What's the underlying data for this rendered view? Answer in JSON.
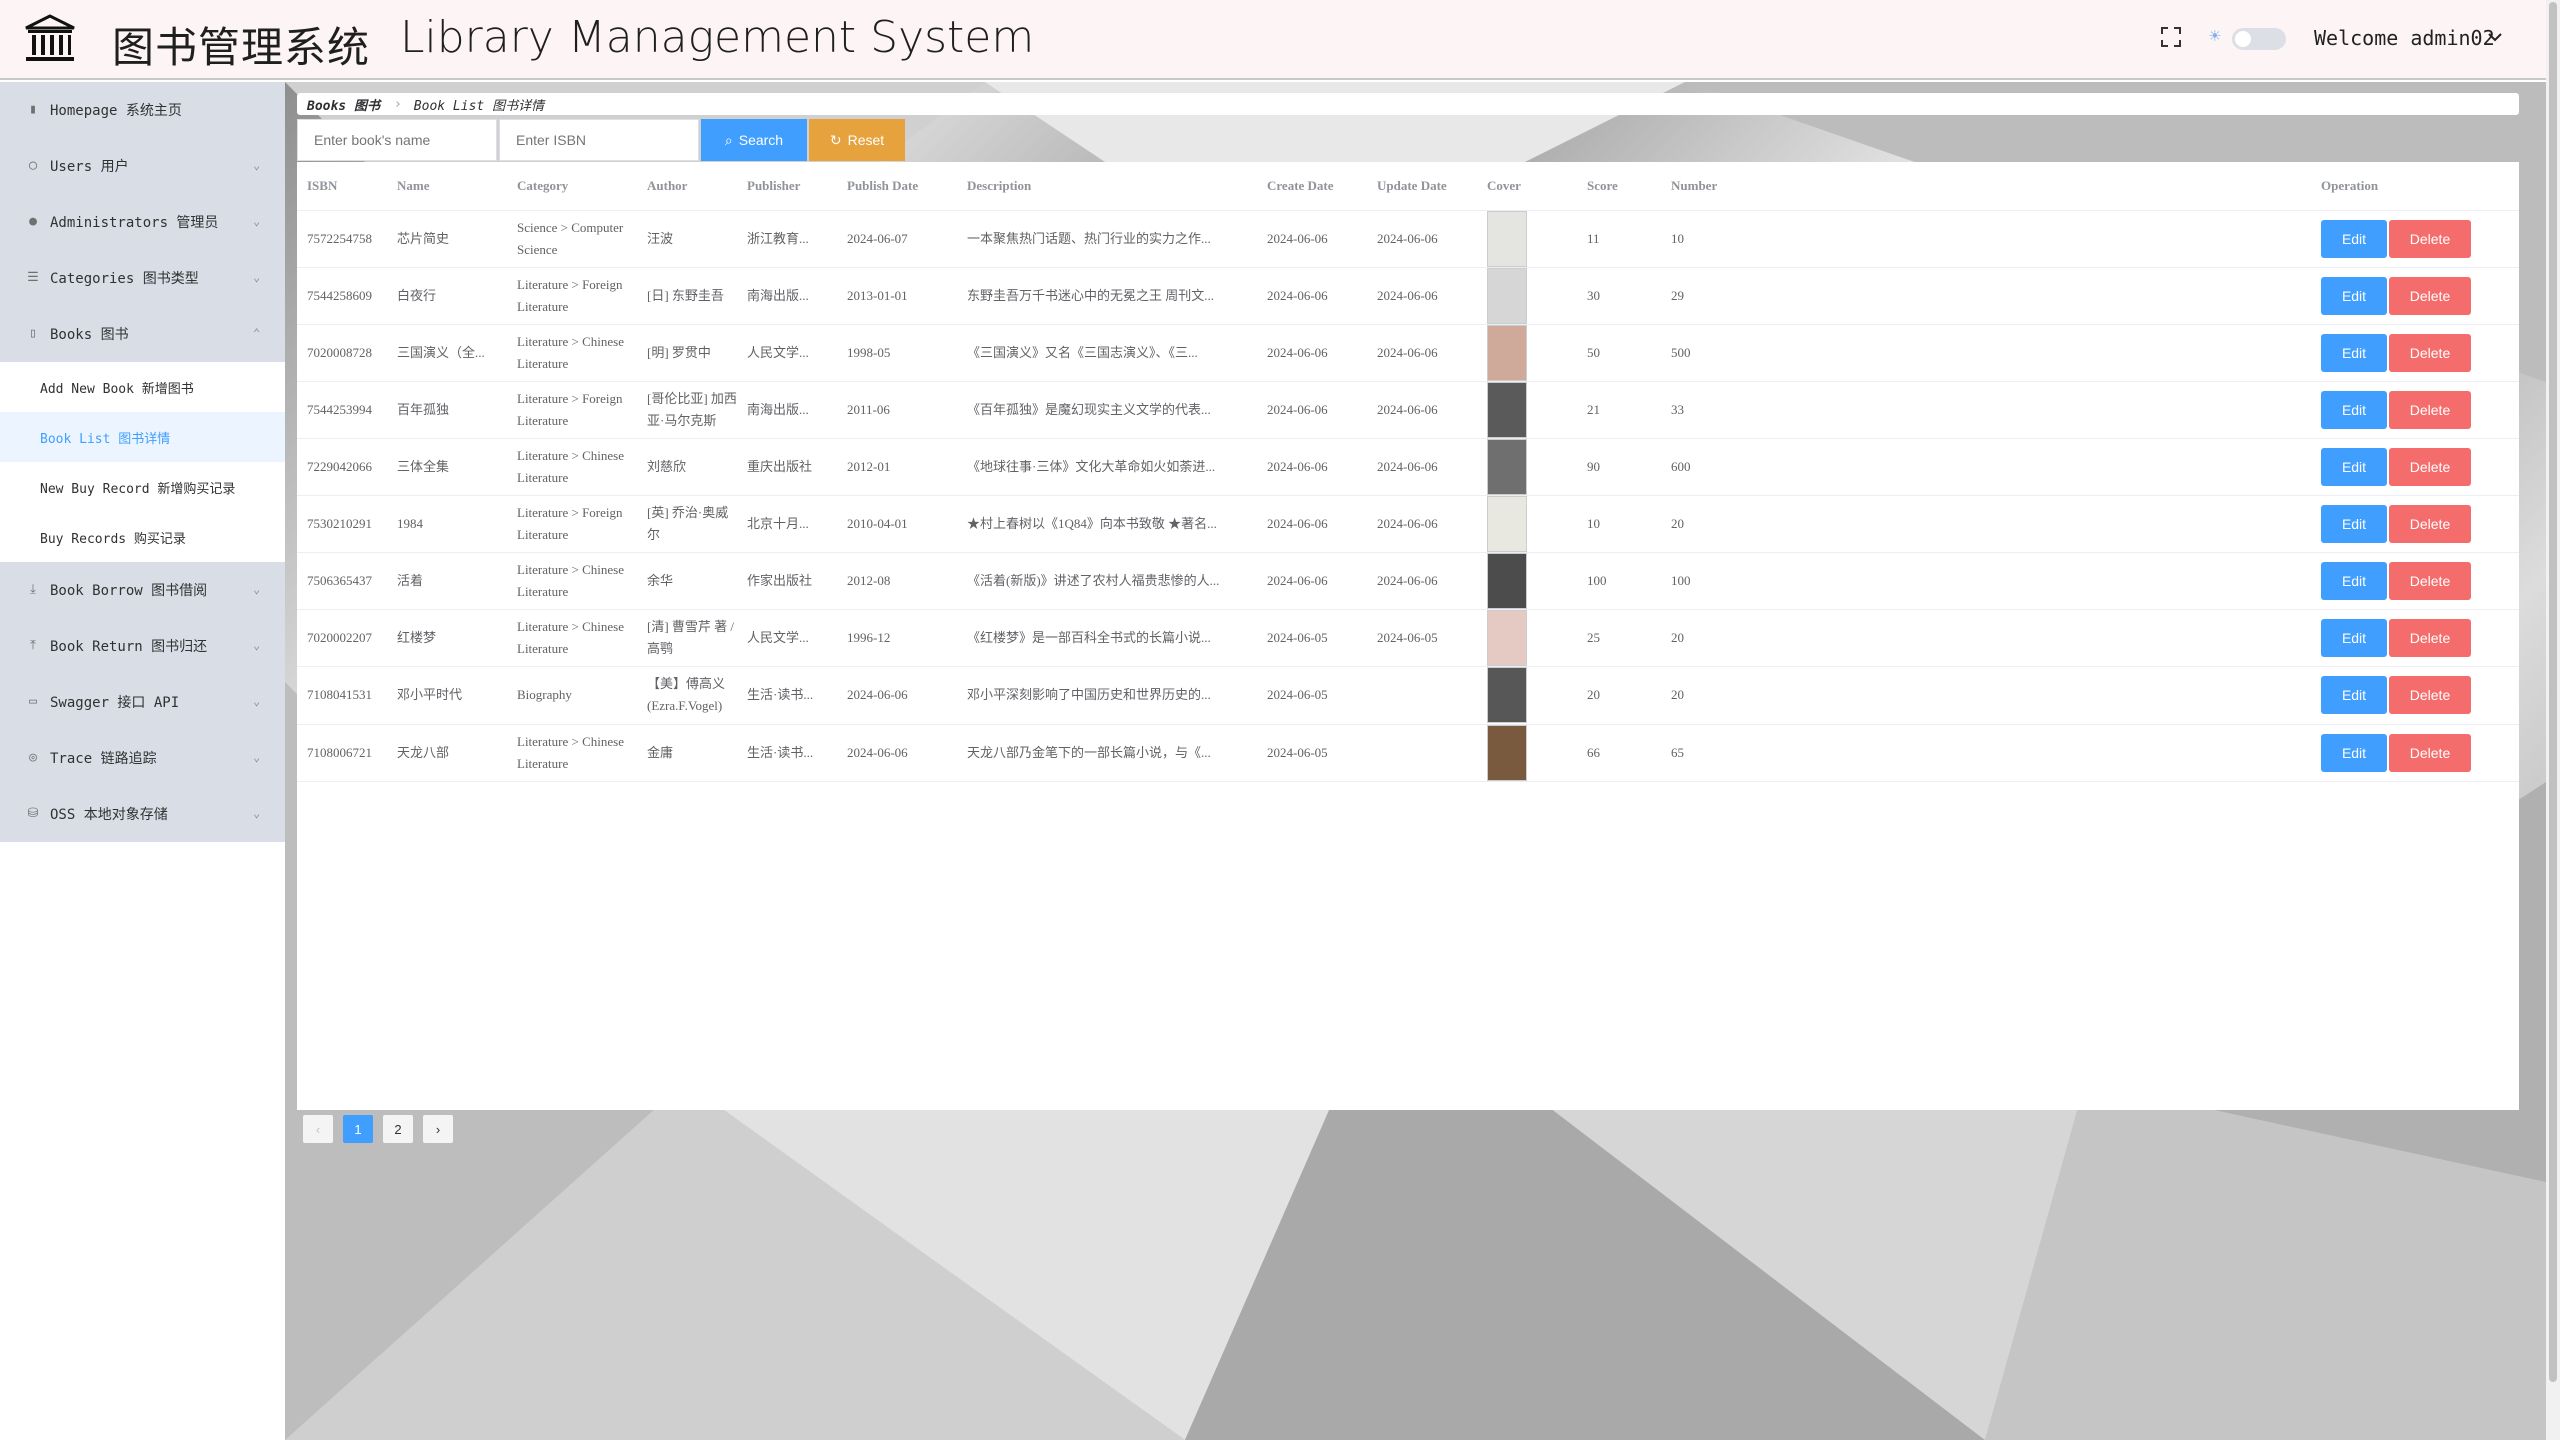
{
  "header": {
    "title_cn": "图书管理系统",
    "title_en": "Library Management System",
    "welcome": "Welcome admin02"
  },
  "sidebar": {
    "items": [
      {
        "label": "Homepage 系统主页",
        "icon": "bar-chart-icon",
        "has_chevron": false
      },
      {
        "label": "Users 用户",
        "icon": "user-icon",
        "has_chevron": true
      },
      {
        "label": "Administrators 管理员",
        "icon": "admin-icon",
        "has_chevron": true
      },
      {
        "label": "Categories 图书类型",
        "icon": "list-icon",
        "has_chevron": true
      },
      {
        "label": "Books 图书",
        "icon": "book-icon",
        "has_chevron": true,
        "expanded": true
      }
    ],
    "books_sub": [
      {
        "label": "Add New Book 新增图书",
        "active": false
      },
      {
        "label": "Book List 图书详情",
        "active": true
      },
      {
        "label": "New Buy Record 新增购买记录",
        "active": false
      },
      {
        "label": "Buy Records 购买记录",
        "active": false
      }
    ],
    "items_after": [
      {
        "label": "Book Borrow 图书借阅",
        "icon": "download-icon"
      },
      {
        "label": "Book Return 图书归还",
        "icon": "upload-icon"
      },
      {
        "label": "Swagger 接口 API",
        "icon": "folder-icon"
      },
      {
        "label": "Trace 链路追踪",
        "icon": "trace-icon"
      },
      {
        "label": "OSS 本地对象存储",
        "icon": "database-icon"
      }
    ]
  },
  "breadcrumb": {
    "first": "Books 图书",
    "second": "Book List 图书详情"
  },
  "search": {
    "name_placeholder": "Enter book's name",
    "isbn_placeholder": "Enter ISBN",
    "search_label": "Search",
    "reset_label": "Reset"
  },
  "table": {
    "columns": [
      "ISBN",
      "Name",
      "Category",
      "Author",
      "Publisher",
      "Publish Date",
      "Description",
      "Create Date",
      "Update Date",
      "Cover",
      "Score",
      "Number",
      "Operation"
    ],
    "edit_label": "Edit",
    "delete_label": "Delete",
    "rows": [
      {
        "isbn": "7572254758",
        "name": "芯片简史",
        "category": "Science > Computer Science",
        "author": "汪波",
        "publisher": "浙江教育...",
        "publish_date": "2024-06-07",
        "description": "一本聚焦热门话题、热门行业的实力之作...",
        "create_date": "2024-06-06",
        "update_date": "2024-06-06",
        "cover_color": "#e4e4e0",
        "score": "11",
        "number": "10"
      },
      {
        "isbn": "7544258609",
        "name": "白夜行",
        "category": "Literature > Foreign Literature",
        "author": "[日] 东野圭吾",
        "publisher": "南海出版...",
        "publish_date": "2013-01-01",
        "description": "东野圭吾万千书迷心中的无冕之王 周刊文...",
        "create_date": "2024-06-06",
        "update_date": "2024-06-06",
        "cover_color": "#d6d6d6",
        "score": "30",
        "number": "29"
      },
      {
        "isbn": "7020008728",
        "name": "三国演义（全...",
        "category": "Literature > Chinese Literature",
        "author": "[明] 罗贯中",
        "publisher": "人民文学...",
        "publish_date": "1998-05",
        "description": "《三国演义》又名《三国志演义》、《三...",
        "create_date": "2024-06-06",
        "update_date": "2024-06-06",
        "cover_color": "#cfa99a",
        "score": "50",
        "number": "500"
      },
      {
        "isbn": "7544253994",
        "name": "百年孤独",
        "category": "Literature > Foreign Literature",
        "author": "[哥伦比亚] 加西亚·马尔克斯",
        "publisher": "南海出版...",
        "publish_date": "2011-06",
        "description": "《百年孤独》是魔幻现实主义文学的代表...",
        "create_date": "2024-06-06",
        "update_date": "2024-06-06",
        "cover_color": "#5a5a5a",
        "score": "21",
        "number": "33"
      },
      {
        "isbn": "7229042066",
        "name": "三体全集",
        "category": "Literature > Chinese Literature",
        "author": "刘慈欣",
        "publisher": "重庆出版社",
        "publish_date": "2012-01",
        "description": "《地球往事·三体》文化大革命如火如荼进...",
        "create_date": "2024-06-06",
        "update_date": "2024-06-06",
        "cover_color": "#6f6f6f",
        "score": "90",
        "number": "600"
      },
      {
        "isbn": "7530210291",
        "name": "1984",
        "category": "Literature > Foreign Literature",
        "author": "[英] 乔治·奥威尔",
        "publisher": "北京十月...",
        "publish_date": "2010-04-01",
        "description": "★村上春树以《1Q84》向本书致敬 ★著名...",
        "create_date": "2024-06-06",
        "update_date": "2024-06-06",
        "cover_color": "#e8e8e0",
        "score": "10",
        "number": "20"
      },
      {
        "isbn": "7506365437",
        "name": "活着",
        "category": "Literature > Chinese Literature",
        "author": "余华",
        "publisher": "作家出版社",
        "publish_date": "2012-08",
        "description": "《活着(新版)》讲述了农村人福贵悲惨的人...",
        "create_date": "2024-06-06",
        "update_date": "2024-06-06",
        "cover_color": "#4c4c4c",
        "score": "100",
        "number": "100"
      },
      {
        "isbn": "7020002207",
        "name": "红楼梦",
        "category": "Literature > Chinese Literature",
        "author": "[清] 曹雪芹 著 / 高鹗",
        "publisher": "人民文学...",
        "publish_date": "1996-12",
        "description": "《红楼梦》是一部百科全书式的长篇小说...",
        "create_date": "2024-06-05",
        "update_date": "2024-06-05",
        "cover_color": "#e5c9c3",
        "score": "25",
        "number": "20"
      },
      {
        "isbn": "7108041531",
        "name": "邓小平时代",
        "category": "Biography",
        "author": "【美】傅高义 (Ezra.F.Vogel)",
        "publisher": "生活·读书...",
        "publish_date": "2024-06-06",
        "description": "邓小平深刻影响了中国历史和世界历史的...",
        "create_date": "2024-06-05",
        "update_date": "",
        "cover_color": "#575757",
        "score": "20",
        "number": "20"
      },
      {
        "isbn": "7108006721",
        "name": "天龙八部",
        "category": "Literature > Chinese Literature",
        "author": "金庸",
        "publisher": "生活·读书...",
        "publish_date": "2024-06-06",
        "description": "天龙八部乃金笔下的一部长篇小说，与《...",
        "create_date": "2024-06-05",
        "update_date": "",
        "cover_color": "#7a5a3e",
        "score": "66",
        "number": "65"
      }
    ]
  },
  "pagination": {
    "pages": [
      "1",
      "2"
    ],
    "current": "1"
  }
}
